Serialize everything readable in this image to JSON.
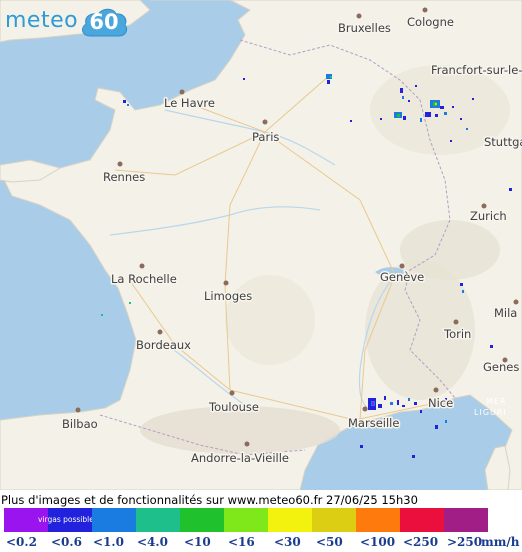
{
  "brand": {
    "name": "meteo",
    "badge": "60",
    "color": "#2e9bd6"
  },
  "footer": {
    "info_text": "Plus d'images et de fonctionnalités sur www.meteo60.fr 27/06/25 15h30"
  },
  "legend": {
    "unit": "mm/h",
    "swatches": [
      {
        "color": "#9a14f0",
        "label": "<0.2"
      },
      {
        "color": "#2222dd",
        "label": "<0.6",
        "note": "virgas possibles"
      },
      {
        "color": "#1a7be0",
        "label": "<1.0"
      },
      {
        "color": "#1fbf8c",
        "label": "<4.0"
      },
      {
        "color": "#1fc12c",
        "label": "<10"
      },
      {
        "color": "#7ee81a",
        "label": "<16"
      },
      {
        "color": "#f2f20e",
        "label": "<30"
      },
      {
        "color": "#dcce12",
        "label": "<50"
      },
      {
        "color": "#ff7a0d",
        "label": "<100"
      },
      {
        "color": "#ea0f3c",
        "label": "<250"
      },
      {
        "color": "#a01e86",
        "label": ">250"
      }
    ]
  },
  "map": {
    "cities": [
      "Bruxelles",
      "Cologne",
      "Francfort-sur-le-",
      "Le Havre",
      "Paris",
      "Stuttga",
      "Rennes",
      "Zurich",
      "Genève",
      "La Rochelle",
      "Limoges",
      "Mila",
      "Torin",
      "Bordeaux",
      "Genes",
      "Toulouse",
      "Nice",
      "Marseille",
      "Bilbao",
      "Andorre-la-Vieille"
    ],
    "seas": [
      "MER",
      "LIGURI"
    ]
  }
}
